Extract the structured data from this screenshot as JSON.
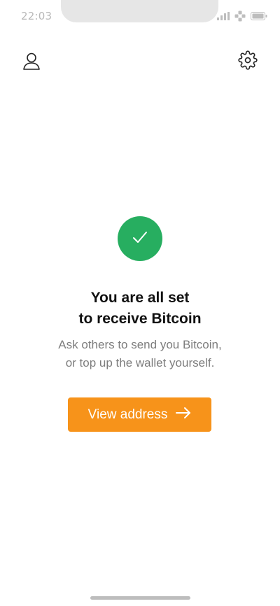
{
  "status_bar": {
    "time": "22:03",
    "icons": [
      "signal-icon",
      "network-icon",
      "battery-icon"
    ]
  },
  "header": {
    "profile_icon": "user-icon",
    "settings_icon": "gear-icon"
  },
  "main": {
    "success_icon": "check-icon",
    "title_line1": "You are all set",
    "title_line2": "to receive Bitcoin",
    "subtitle_line1": "Ask others to send you Bitcoin,",
    "subtitle_line2": "or top up the wallet yourself.",
    "button_label": "View address",
    "button_icon": "arrow-right-icon"
  },
  "colors": {
    "accent": "#f7931a",
    "success": "#27ae60"
  }
}
